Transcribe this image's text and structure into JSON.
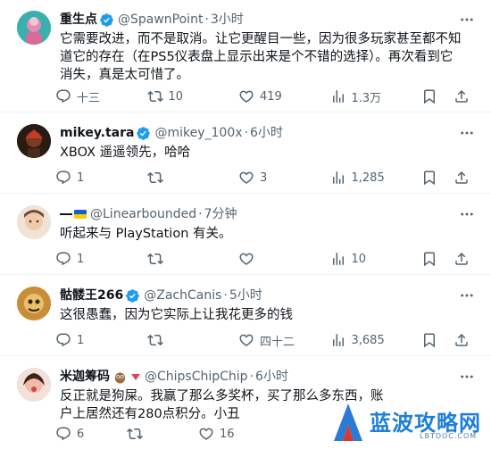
{
  "tweets": [
    {
      "name": "重生点",
      "handle": "@SpawnPoint",
      "time": "3小时",
      "text": "它需要改进，而不是取消。让它更醒目一些，因为很多玩家甚至都不知道它的存在（在PS5仪表盘上显示出来是个不错的选择）。再次看到它消失，真是太可惜了。",
      "replies": "十三",
      "retweets": "10",
      "likes": "419",
      "views": "1.3万"
    },
    {
      "name": "mikey.tara",
      "handle": "@mikey_100x",
      "time": "6小时",
      "text": "XBOX 遥遥领先，哈哈",
      "replies": "1",
      "retweets": "",
      "likes": "3",
      "views": "1,285"
    },
    {
      "name": "",
      "handle": "@Linearbounded",
      "time": "7分钟",
      "text": "听起来与 PlayStation 有关。",
      "replies": "1",
      "retweets": "",
      "likes": "",
      "views": "10"
    },
    {
      "name": "骷髅王266",
      "handle": "@ZachCanis",
      "time": "5小时",
      "text": "这很愚蠢，因为它实际上让我花更多的钱",
      "replies": "1",
      "retweets": "",
      "likes": "四十二",
      "views": "3,685"
    },
    {
      "name": "米迦筹码",
      "handle": "@ChipsChipChip",
      "time": "6小时",
      "text": "反正就是狗屎。我赢了那么多奖杯，买了那么多东西，账户上居然还有280点积分。小丑",
      "replies": "6",
      "retweets": "",
      "likes": "16",
      "views": ""
    }
  ],
  "watermark": {
    "text": "蓝波攻略网",
    "sub": "LBTDOC.COM"
  },
  "colors": {
    "text": "#0f1419",
    "muted": "#536471",
    "verified": "#1d9bf0",
    "divider": "#eff3f4"
  }
}
